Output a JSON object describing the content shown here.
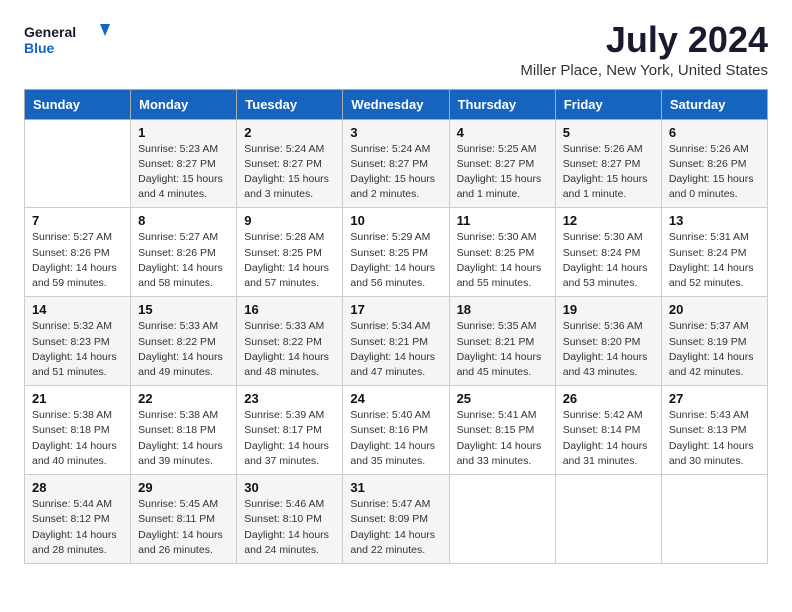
{
  "header": {
    "logo_general": "General",
    "logo_blue": "Blue",
    "title": "July 2024",
    "subtitle": "Miller Place, New York, United States"
  },
  "calendar": {
    "days_of_week": [
      "Sunday",
      "Monday",
      "Tuesday",
      "Wednesday",
      "Thursday",
      "Friday",
      "Saturday"
    ],
    "weeks": [
      [
        {
          "day": "",
          "lines": []
        },
        {
          "day": "1",
          "lines": [
            "Sunrise: 5:23 AM",
            "Sunset: 8:27 PM",
            "Daylight: 15 hours",
            "and 4 minutes."
          ]
        },
        {
          "day": "2",
          "lines": [
            "Sunrise: 5:24 AM",
            "Sunset: 8:27 PM",
            "Daylight: 15 hours",
            "and 3 minutes."
          ]
        },
        {
          "day": "3",
          "lines": [
            "Sunrise: 5:24 AM",
            "Sunset: 8:27 PM",
            "Daylight: 15 hours",
            "and 2 minutes."
          ]
        },
        {
          "day": "4",
          "lines": [
            "Sunrise: 5:25 AM",
            "Sunset: 8:27 PM",
            "Daylight: 15 hours",
            "and 1 minute."
          ]
        },
        {
          "day": "5",
          "lines": [
            "Sunrise: 5:26 AM",
            "Sunset: 8:27 PM",
            "Daylight: 15 hours",
            "and 1 minute."
          ]
        },
        {
          "day": "6",
          "lines": [
            "Sunrise: 5:26 AM",
            "Sunset: 8:26 PM",
            "Daylight: 15 hours",
            "and 0 minutes."
          ]
        }
      ],
      [
        {
          "day": "7",
          "lines": [
            "Sunrise: 5:27 AM",
            "Sunset: 8:26 PM",
            "Daylight: 14 hours",
            "and 59 minutes."
          ]
        },
        {
          "day": "8",
          "lines": [
            "Sunrise: 5:27 AM",
            "Sunset: 8:26 PM",
            "Daylight: 14 hours",
            "and 58 minutes."
          ]
        },
        {
          "day": "9",
          "lines": [
            "Sunrise: 5:28 AM",
            "Sunset: 8:25 PM",
            "Daylight: 14 hours",
            "and 57 minutes."
          ]
        },
        {
          "day": "10",
          "lines": [
            "Sunrise: 5:29 AM",
            "Sunset: 8:25 PM",
            "Daylight: 14 hours",
            "and 56 minutes."
          ]
        },
        {
          "day": "11",
          "lines": [
            "Sunrise: 5:30 AM",
            "Sunset: 8:25 PM",
            "Daylight: 14 hours",
            "and 55 minutes."
          ]
        },
        {
          "day": "12",
          "lines": [
            "Sunrise: 5:30 AM",
            "Sunset: 8:24 PM",
            "Daylight: 14 hours",
            "and 53 minutes."
          ]
        },
        {
          "day": "13",
          "lines": [
            "Sunrise: 5:31 AM",
            "Sunset: 8:24 PM",
            "Daylight: 14 hours",
            "and 52 minutes."
          ]
        }
      ],
      [
        {
          "day": "14",
          "lines": [
            "Sunrise: 5:32 AM",
            "Sunset: 8:23 PM",
            "Daylight: 14 hours",
            "and 51 minutes."
          ]
        },
        {
          "day": "15",
          "lines": [
            "Sunrise: 5:33 AM",
            "Sunset: 8:22 PM",
            "Daylight: 14 hours",
            "and 49 minutes."
          ]
        },
        {
          "day": "16",
          "lines": [
            "Sunrise: 5:33 AM",
            "Sunset: 8:22 PM",
            "Daylight: 14 hours",
            "and 48 minutes."
          ]
        },
        {
          "day": "17",
          "lines": [
            "Sunrise: 5:34 AM",
            "Sunset: 8:21 PM",
            "Daylight: 14 hours",
            "and 47 minutes."
          ]
        },
        {
          "day": "18",
          "lines": [
            "Sunrise: 5:35 AM",
            "Sunset: 8:21 PM",
            "Daylight: 14 hours",
            "and 45 minutes."
          ]
        },
        {
          "day": "19",
          "lines": [
            "Sunrise: 5:36 AM",
            "Sunset: 8:20 PM",
            "Daylight: 14 hours",
            "and 43 minutes."
          ]
        },
        {
          "day": "20",
          "lines": [
            "Sunrise: 5:37 AM",
            "Sunset: 8:19 PM",
            "Daylight: 14 hours",
            "and 42 minutes."
          ]
        }
      ],
      [
        {
          "day": "21",
          "lines": [
            "Sunrise: 5:38 AM",
            "Sunset: 8:18 PM",
            "Daylight: 14 hours",
            "and 40 minutes."
          ]
        },
        {
          "day": "22",
          "lines": [
            "Sunrise: 5:38 AM",
            "Sunset: 8:18 PM",
            "Daylight: 14 hours",
            "and 39 minutes."
          ]
        },
        {
          "day": "23",
          "lines": [
            "Sunrise: 5:39 AM",
            "Sunset: 8:17 PM",
            "Daylight: 14 hours",
            "and 37 minutes."
          ]
        },
        {
          "day": "24",
          "lines": [
            "Sunrise: 5:40 AM",
            "Sunset: 8:16 PM",
            "Daylight: 14 hours",
            "and 35 minutes."
          ]
        },
        {
          "day": "25",
          "lines": [
            "Sunrise: 5:41 AM",
            "Sunset: 8:15 PM",
            "Daylight: 14 hours",
            "and 33 minutes."
          ]
        },
        {
          "day": "26",
          "lines": [
            "Sunrise: 5:42 AM",
            "Sunset: 8:14 PM",
            "Daylight: 14 hours",
            "and 31 minutes."
          ]
        },
        {
          "day": "27",
          "lines": [
            "Sunrise: 5:43 AM",
            "Sunset: 8:13 PM",
            "Daylight: 14 hours",
            "and 30 minutes."
          ]
        }
      ],
      [
        {
          "day": "28",
          "lines": [
            "Sunrise: 5:44 AM",
            "Sunset: 8:12 PM",
            "Daylight: 14 hours",
            "and 28 minutes."
          ]
        },
        {
          "day": "29",
          "lines": [
            "Sunrise: 5:45 AM",
            "Sunset: 8:11 PM",
            "Daylight: 14 hours",
            "and 26 minutes."
          ]
        },
        {
          "day": "30",
          "lines": [
            "Sunrise: 5:46 AM",
            "Sunset: 8:10 PM",
            "Daylight: 14 hours",
            "and 24 minutes."
          ]
        },
        {
          "day": "31",
          "lines": [
            "Sunrise: 5:47 AM",
            "Sunset: 8:09 PM",
            "Daylight: 14 hours",
            "and 22 minutes."
          ]
        },
        {
          "day": "",
          "lines": []
        },
        {
          "day": "",
          "lines": []
        },
        {
          "day": "",
          "lines": []
        }
      ]
    ]
  }
}
